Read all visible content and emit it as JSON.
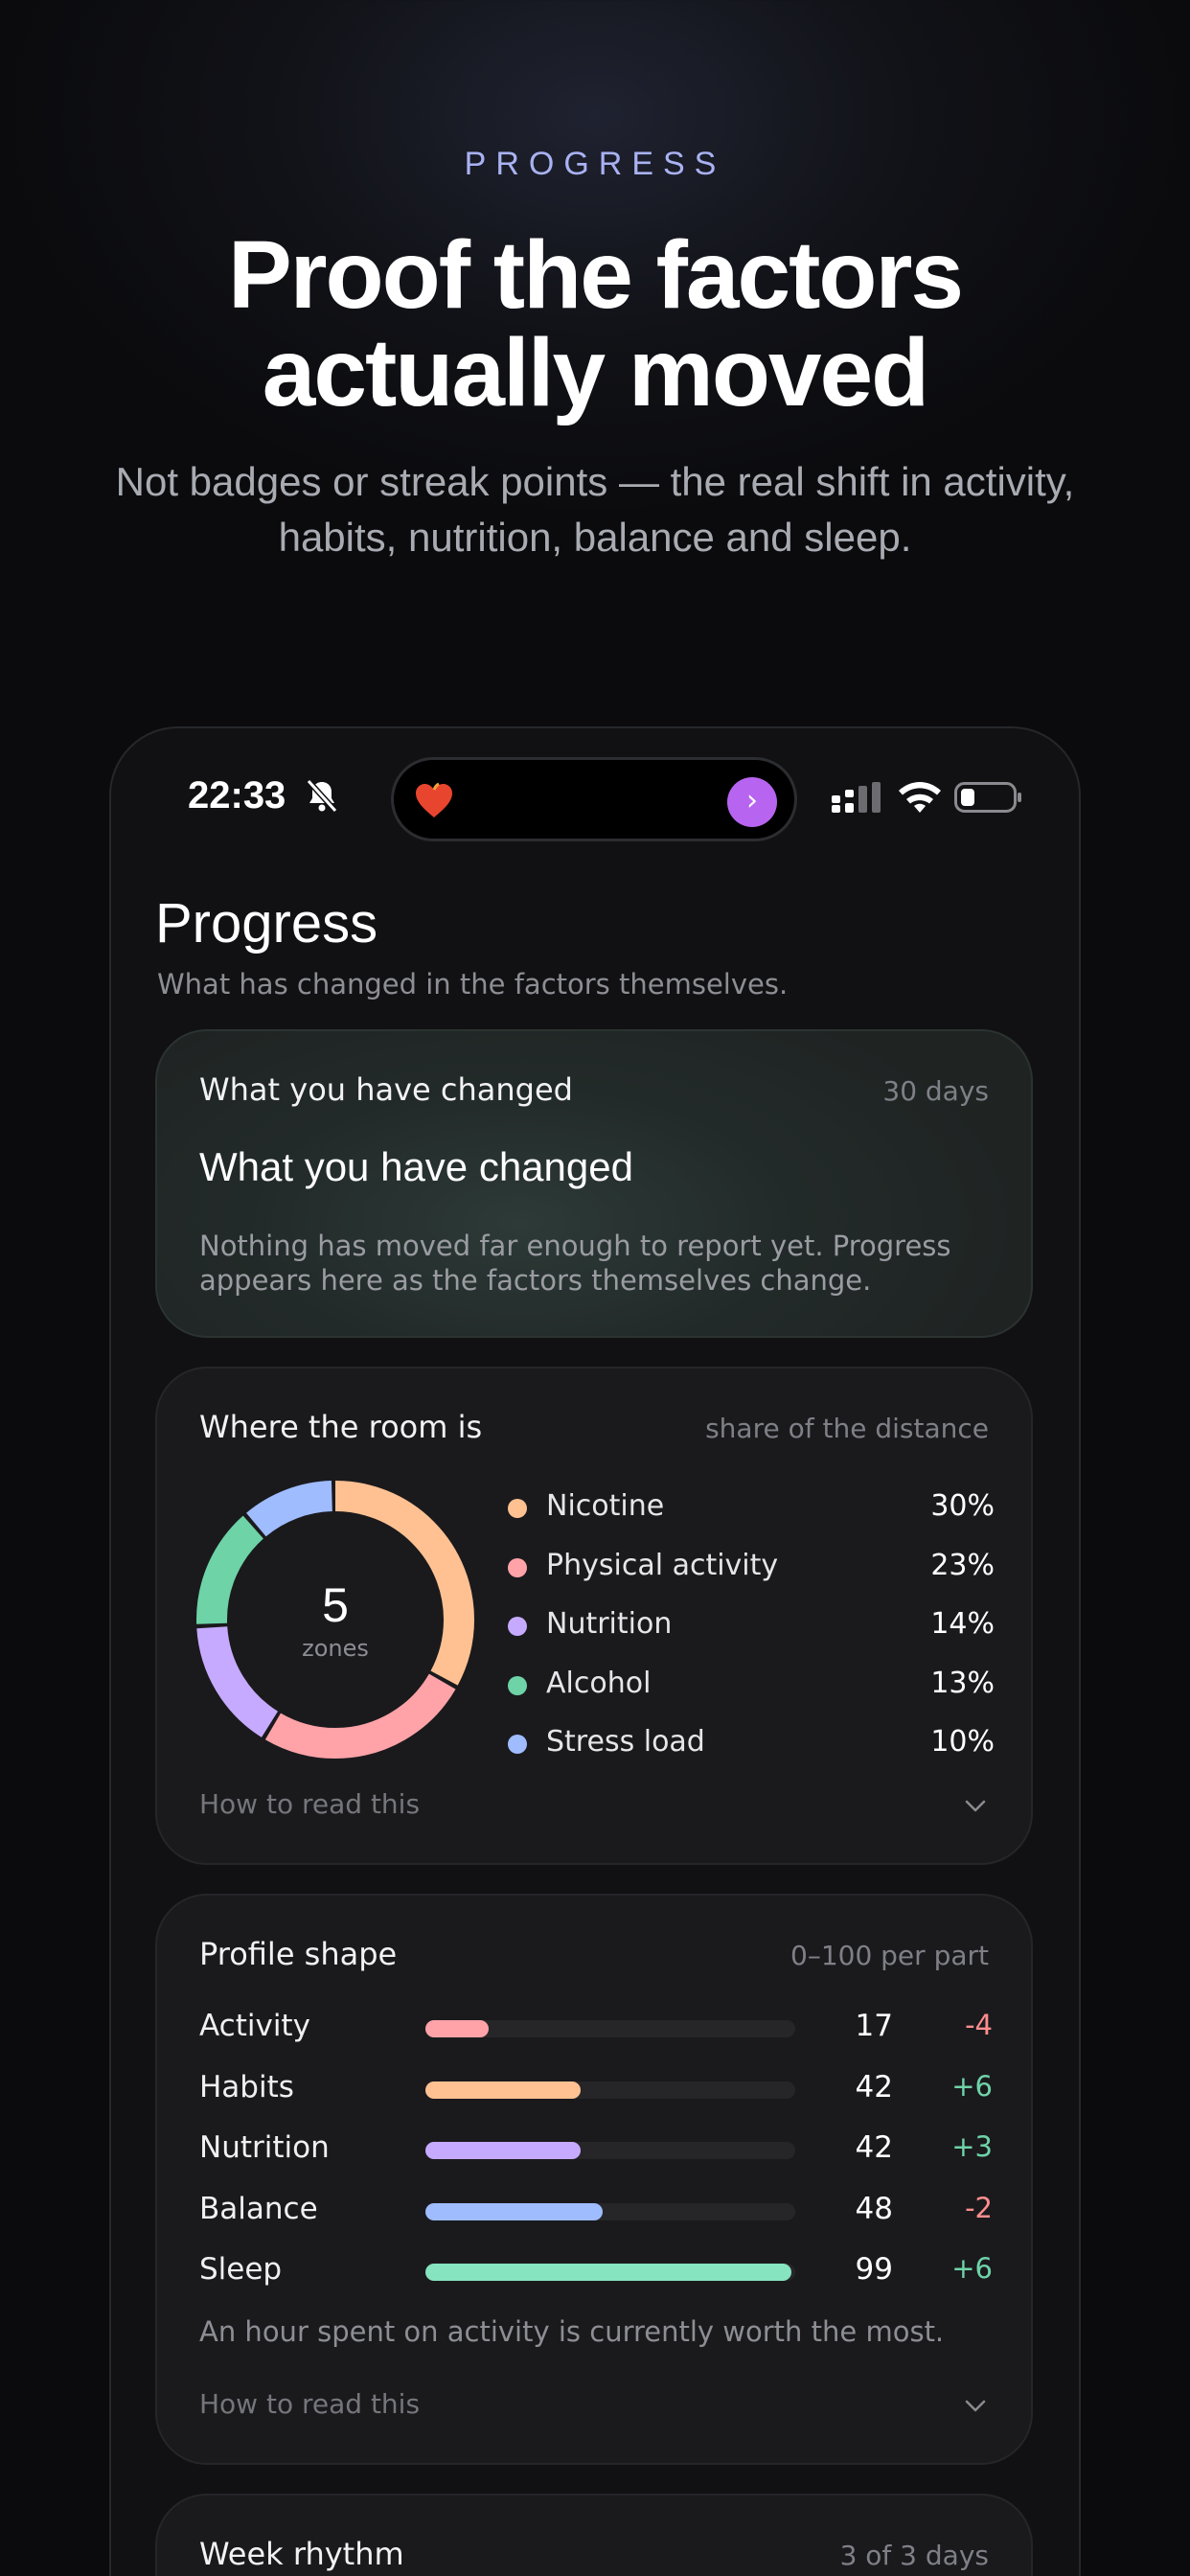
{
  "hero": {
    "eyebrow": "PROGRESS",
    "title_line1": "Proof the factors",
    "title_line2": "actually moved",
    "subtitle_line1": "Not badges or streak points — the real shift in activity,",
    "subtitle_line2": "habits, nutrition, balance and sleep."
  },
  "status_bar": {
    "time": "22:33",
    "icons": [
      "bell-muted-icon",
      "heart-icon",
      "chevron-right-icon",
      "signal-icon",
      "wifi-icon",
      "battery-icon"
    ]
  },
  "screen": {
    "title": "Progress",
    "subtitle": "What has changed in the factors themselves."
  },
  "changed_card": {
    "heading": "What you have changed",
    "period": "30 days",
    "title": "What you have changed",
    "body": "Nothing has moved far enough to report yet. Progress appears here as the factors themselves change."
  },
  "room_card": {
    "heading": "Where the room is",
    "meta": "share of the distance",
    "center_value": "5",
    "center_label": "zones",
    "how_to_read": "How to read this",
    "items": [
      {
        "label": "Nicotine",
        "value": "30%",
        "share": 30,
        "color": "#ffc192"
      },
      {
        "label": "Physical activity",
        "value": "23%",
        "share": 23,
        "color": "#ffa3a8"
      },
      {
        "label": "Nutrition",
        "value": "14%",
        "share": 14,
        "color": "#c6aaff"
      },
      {
        "label": "Alcohol",
        "value": "13%",
        "share": 13,
        "color": "#6ed3a7"
      },
      {
        "label": "Stress load",
        "value": "10%",
        "share": 10,
        "color": "#9fbcff"
      }
    ]
  },
  "profile_card": {
    "heading": "Profile shape",
    "meta": "0–100 per part",
    "note": "An hour spent on activity is currently worth the most.",
    "how_to_read": "How to read this",
    "rows": [
      {
        "label": "Activity",
        "score": 17,
        "value": "17",
        "delta": "-4",
        "color": "#ffa3a8",
        "delta_color": "#ff8e8e"
      },
      {
        "label": "Habits",
        "score": 42,
        "value": "42",
        "delta": "+6",
        "color": "#ffc192",
        "delta_color": "#6fd3a8"
      },
      {
        "label": "Nutrition",
        "score": 42,
        "value": "42",
        "delta": "+3",
        "color": "#c6aaff",
        "delta_color": "#6fd3a8"
      },
      {
        "label": "Balance",
        "score": 48,
        "value": "48",
        "delta": "-2",
        "color": "#9fbcff",
        "delta_color": "#ff8e8e"
      },
      {
        "label": "Sleep",
        "score": 99,
        "value": "99",
        "delta": "+6",
        "color": "#86e4c0",
        "delta_color": "#6fd3a8"
      }
    ]
  },
  "week_card": {
    "heading": "Week rhythm",
    "meta": "3 of 3 days"
  }
}
